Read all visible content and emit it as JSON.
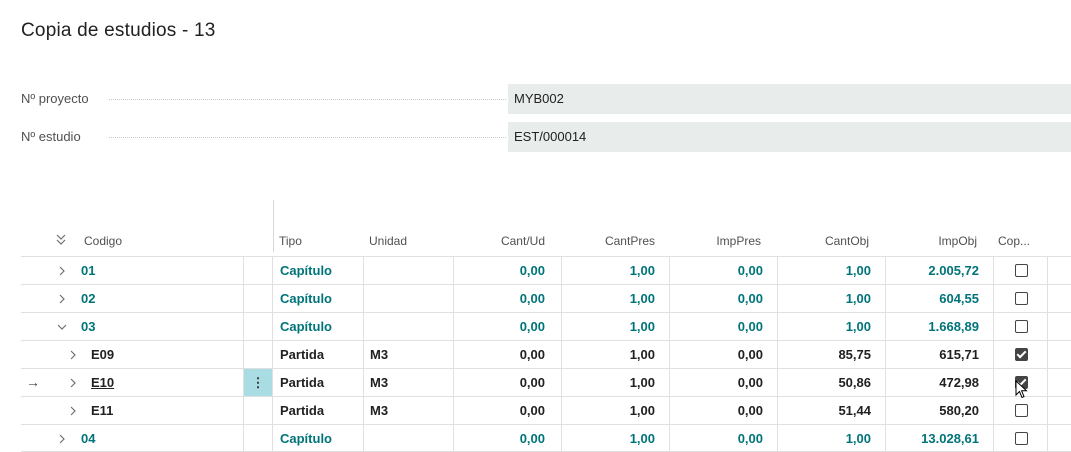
{
  "page": {
    "title": "Copia de estudios - 13"
  },
  "fields": [
    {
      "label": "Nº proyecto",
      "value": "MYB002"
    },
    {
      "label": "Nº estudio",
      "value": "EST/000014"
    }
  ],
  "grid": {
    "columns": {
      "codigo": "Codigo",
      "tipo": "Tipo",
      "unidad": "Unidad",
      "cant_ud": "Cant/Ud",
      "cant_pres": "CantPres",
      "imp_pres": "ImpPres",
      "cant_obj": "CantObj",
      "imp_obj": "ImpObj",
      "copiar": "Cop..."
    },
    "rows": [
      {
        "codigo": "01",
        "tipo": "Capítulo",
        "unidad": "",
        "cant_ud": "0,00",
        "cant_pres": "1,00",
        "imp_pres": "0,00",
        "cant_obj": "1,00",
        "imp_obj": "2.005,72",
        "copiar": false
      },
      {
        "codigo": "02",
        "tipo": "Capítulo",
        "unidad": "",
        "cant_ud": "0,00",
        "cant_pres": "1,00",
        "imp_pres": "0,00",
        "cant_obj": "1,00",
        "imp_obj": "604,55",
        "copiar": false
      },
      {
        "codigo": "03",
        "tipo": "Capítulo",
        "unidad": "",
        "cant_ud": "0,00",
        "cant_pres": "1,00",
        "imp_pres": "0,00",
        "cant_obj": "1,00",
        "imp_obj": "1.668,89",
        "copiar": false
      },
      {
        "codigo": "E09",
        "tipo": "Partida",
        "unidad": "M3",
        "cant_ud": "0,00",
        "cant_pres": "1,00",
        "imp_pres": "0,00",
        "cant_obj": "85,75",
        "imp_obj": "615,71",
        "copiar": true
      },
      {
        "codigo": "E10",
        "tipo": "Partida",
        "unidad": "M3",
        "cant_ud": "0,00",
        "cant_pres": "1,00",
        "imp_pres": "0,00",
        "cant_obj": "50,86",
        "imp_obj": "472,98",
        "copiar": true
      },
      {
        "codigo": "E11",
        "tipo": "Partida",
        "unidad": "M3",
        "cant_ud": "0,00",
        "cant_pres": "1,00",
        "imp_pres": "0,00",
        "cant_obj": "51,44",
        "imp_obj": "580,20",
        "copiar": false
      },
      {
        "codigo": "04",
        "tipo": "Capítulo",
        "unidad": "",
        "cant_ud": "0,00",
        "cant_pres": "1,00",
        "imp_pres": "0,00",
        "cant_obj": "1,00",
        "imp_obj": "13.028,61",
        "copiar": false
      }
    ]
  },
  "icons": {
    "collapse_all": "double-chevron-down-icon",
    "row_collapsed": "chevron-right-icon",
    "row_expanded": "chevron-down-icon",
    "current_row": "arrow-right-icon",
    "row_menu": "vertical-ellipsis-icon"
  },
  "colors": {
    "chapter_text": "#00747a",
    "selected_menu_bg": "#a9dde3",
    "field_bg": "#e8edec"
  }
}
